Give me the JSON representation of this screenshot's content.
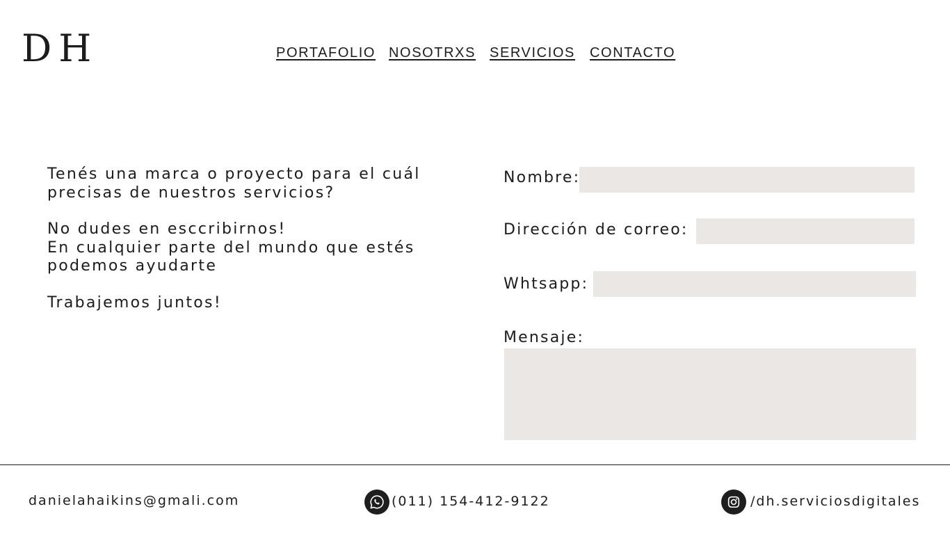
{
  "header": {
    "logo": "DH",
    "nav": {
      "portafolio": "PORTAFOLIO",
      "nosotrxs": "NOSOTRXS",
      "servicios": "SERVICIOS",
      "contacto": "CONTACTO"
    }
  },
  "intro": {
    "line1": "Tenés una marca o proyecto para el cuál",
    "line2": "precisas de nuestros servicios?",
    "line3": "No dudes en esccribirnos!",
    "line4": "En cualquier parte del mundo que estés",
    "line5": "podemos ayudarte",
    "line6": "Trabajemos juntos!"
  },
  "form": {
    "nombre_label": "Nombre:",
    "correo_label": "Dirección de correo:",
    "whatsapp_label": "Whtsapp:",
    "mensaje_label": "Mensaje:",
    "field_color": "#ebe7e4"
  },
  "footer": {
    "email": "danielahaikins@gmali.com",
    "phone": "(011) 154-412-9122",
    "instagram": "/dh.serviciosdigitales",
    "phone_icon": "whatsapp-icon",
    "social_icon": "instagram-icon"
  }
}
